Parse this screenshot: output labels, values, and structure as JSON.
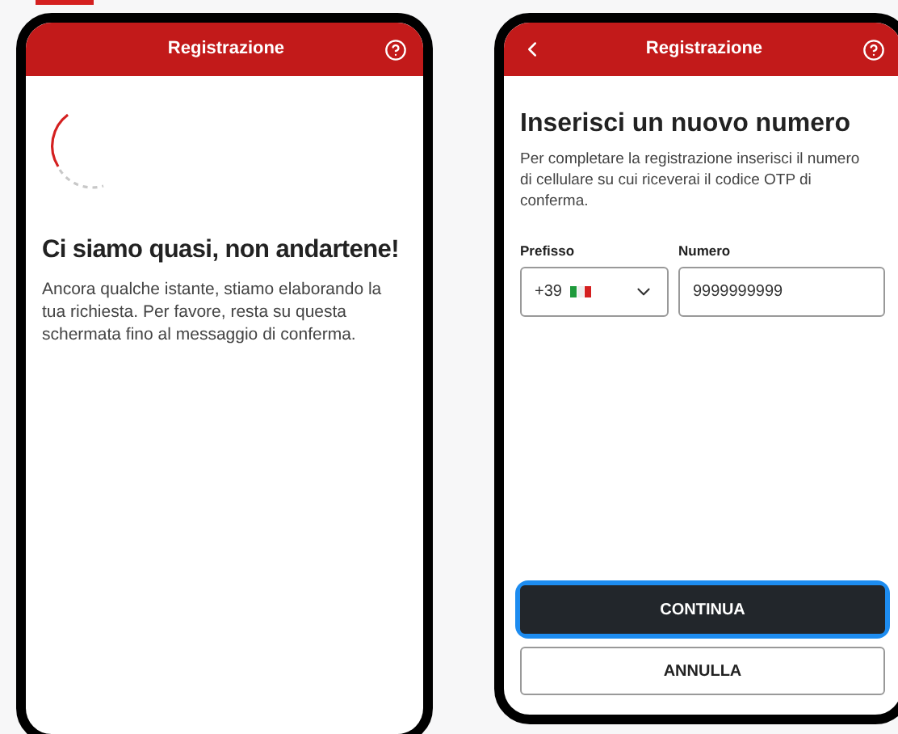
{
  "screens": [
    {
      "kind": "loading",
      "header": {
        "title": "Registrazione",
        "back": false
      },
      "heading": "Ci siamo quasi, non andartene!",
      "body": "Ancora qualche istante, stiamo elaborando la tua richiesta. Per favore, resta su questa schermata fino al messaggio di conferma."
    },
    {
      "kind": "form",
      "header": {
        "title": "Registrazione",
        "back": true
      },
      "heading": "Inserisci un nuovo numero",
      "body": "Per completare la registrazione inserisci il numero di cellulare su cui riceverai il codice OTP di conferma.",
      "prefix": {
        "label": "Prefisso",
        "value": "+39"
      },
      "number": {
        "label": "Numero",
        "value": "9999999999"
      },
      "buttons": [
        {
          "label": "CONTINUA",
          "kind": "primary",
          "focused": true
        },
        {
          "label": "ANNULLA",
          "kind": "secondary",
          "focused": false
        }
      ]
    }
  ]
}
